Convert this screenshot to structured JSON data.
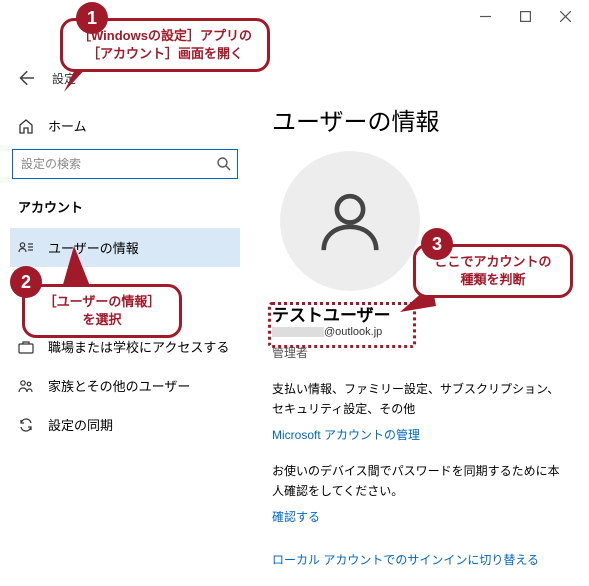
{
  "window": {
    "app_title": "設定"
  },
  "sidebar": {
    "home_label": "ホーム",
    "search_placeholder": "設定の検索",
    "section_label": "アカウント",
    "items": [
      {
        "label": "ユーザーの情報"
      },
      {
        "label": "職場または学校にアクセスする"
      },
      {
        "label": "家族とその他のユーザー"
      },
      {
        "label": "設定の同期"
      }
    ]
  },
  "main": {
    "page_title": "ユーザーの情報",
    "user_name": "テストユーザー",
    "email_domain": "@outlook.jp",
    "role": "管理者",
    "text1": "支払い情報、ファミリー設定、サブスクリプション、セキュリティ設定、その他",
    "link1": "Microsoft アカウントの管理",
    "text2": "お使いのデバイス間でパスワードを同期するために本人確認をしてください。",
    "link2": "確認する",
    "link3": "ローカル アカウントでのサインインに切り替える"
  },
  "annotations": {
    "b1": "1",
    "c1": "［Windowsの設定］アプリの［アカウント］画面を開く",
    "b2": "2",
    "c2": "［ユーザーの情報］を選択",
    "b3": "3",
    "c3": "ここでアカウントの種類を判断"
  }
}
